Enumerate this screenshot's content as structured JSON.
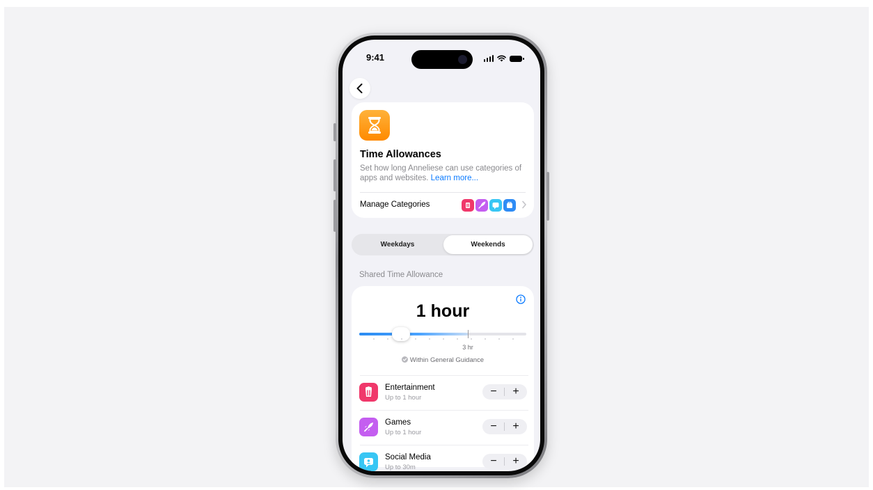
{
  "status_bar": {
    "time": "9:41"
  },
  "header": {
    "title": "Time Allowances",
    "description": "Set how long Anneliese can use categories of apps and websites.",
    "learn_more": "Learn more...",
    "manage_categories": "Manage Categories",
    "category_icons": [
      {
        "name": "entertainment-icon",
        "color": "#f0386b"
      },
      {
        "name": "games-icon",
        "color": "#c45ef0"
      },
      {
        "name": "social-media-icon",
        "color": "#38c6f4"
      },
      {
        "name": "productivity-icon",
        "color": "#2f8cf5"
      }
    ]
  },
  "segments": {
    "weekdays": "Weekdays",
    "weekends": "Weekends",
    "selected": "Weekends"
  },
  "allowance": {
    "section_label": "Shared Time Allowance",
    "value_label": "1 hour",
    "slider_fraction": 0.25,
    "guidance_fraction": 0.65,
    "guidance_tick_label": "3 hr",
    "guidance_text": "Within General Guidance"
  },
  "categories": [
    {
      "title": "Entertainment",
      "subtitle": "Up to 1 hour",
      "color": "#f0386b"
    },
    {
      "title": "Games",
      "subtitle": "Up to 1 hour",
      "color": "#c45ef0"
    },
    {
      "title": "Social Media",
      "subtitle": "Up to 30m",
      "color": "#38c6f4"
    }
  ],
  "stepper": {
    "minus": "−",
    "plus": "+"
  },
  "colors": {
    "accent": "#0a7aff",
    "allowance_tile": "#ff9500",
    "background": "#f2f2f7"
  }
}
